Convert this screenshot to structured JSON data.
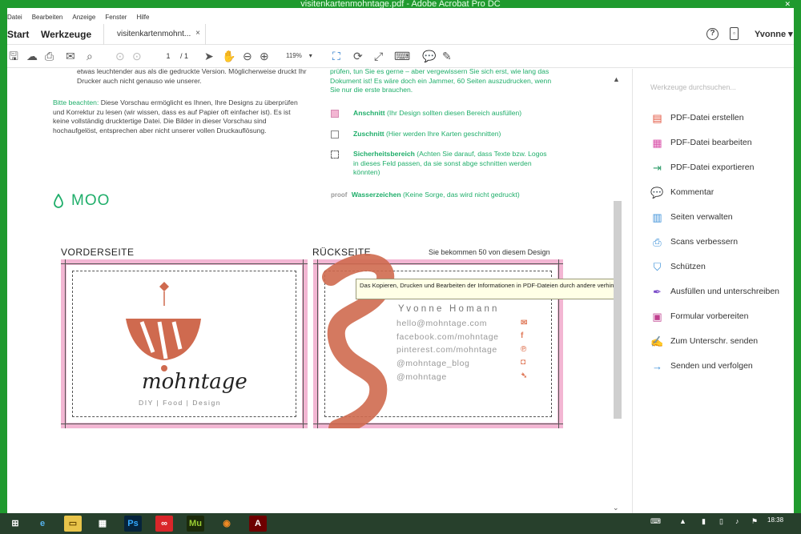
{
  "window": {
    "title": "visitenkartenmohntage.pdf - Adobe Acrobat Pro DC"
  },
  "menu": [
    "Datei",
    "Bearbeiten",
    "Anzeige",
    "Fenster",
    "Hilfe"
  ],
  "tabs": {
    "start": "Start",
    "tools": "Werkzeuge",
    "document": "visitenkartenmohnt...",
    "close": "×"
  },
  "header": {
    "user": "Yvonne"
  },
  "toolbar": {
    "page_current": "1",
    "page_total": "/ 1",
    "zoom": "119%"
  },
  "document": {
    "left_para1": "etwas leuchtender aus als die gedruckte Version. Möglicherweise druckt Ihr Drucker auch nicht genauso wie unserer.",
    "left_para2_hl": "Bitte beachten:",
    "left_para2": " Diese Vorschau ermöglicht es Ihnen, Ihre Designs zu überprüfen und Korrektur zu lesen (wir wissen, dass es auf Papier oft einfacher ist). Es ist keine vollständig drucktertige Datei. Die Bilder in dieser Vorschau sind hochaufgelöst, entsprechen aber nicht unserer vollen Druckauflösung.",
    "right_para": "prüfen, tun Sie es gerne – aber vergewissern Sie sich erst, wie lang das Dokument ist! Es wäre doch ein Jammer, 60 Seiten auszudrucken, wenn Sie nur die erste brauchen.",
    "legend": [
      {
        "term": "Anschnitt",
        "desc": " (Ihr Design sollten diesen Bereich ausfüllen)"
      },
      {
        "term": "Zuschnitt",
        "desc": " (Hier werden Ihre Karten geschnitten)"
      },
      {
        "term": "Sicherheitsbereich",
        "desc": " (Achten Sie darauf, dass Texte bzw. Logos in dieses Feld passen, da sie sonst abge schnitten werden könnten)"
      },
      {
        "prefix": "proof",
        "term": "Wasserzeichen",
        "desc": " (Keine Sorge, das wird nicht gedruckt)"
      }
    ],
    "logo": "MOO",
    "front_label": "VORDERSEITE",
    "back_label": "RÜCKSEITE",
    "count_label": "Sie bekommen 50 von diesem Design",
    "brand_name": "mohntage",
    "brand_sub": "DIY | Food | Design",
    "back_card": {
      "name": "Yvonne Homann",
      "lines": [
        "hello@mohntage.com",
        "facebook.com/mohntage",
        "pinterest.com/mohntage",
        "@mohntage_blog",
        "@mohntage"
      ]
    },
    "tooltip": "Das Kopieren, Drucken und Bearbeiten der Informationen in PDF-Dateien durch andere verhindern"
  },
  "tools_pane": {
    "search_placeholder": "Werkzeuge durchsuchen...",
    "items": [
      {
        "label": "PDF-Datei erstellen",
        "color": "#e2513b"
      },
      {
        "label": "PDF-Datei bearbeiten",
        "color": "#d84aa6"
      },
      {
        "label": "PDF-Datei exportieren",
        "color": "#2e9c6a"
      },
      {
        "label": "Kommentar",
        "color": "#f0c020"
      },
      {
        "label": "Seiten verwalten",
        "color": "#3a8fd8"
      },
      {
        "label": "Scans verbessern",
        "color": "#3a8fd8"
      },
      {
        "label": "Schützen",
        "color": "#3a8fd8"
      },
      {
        "label": "Ausfüllen und unterschreiben",
        "color": "#7b4dc9"
      },
      {
        "label": "Formular vorbereiten",
        "color": "#c0408f"
      },
      {
        "label": "Zum Unterschr. senden",
        "color": "#3a5fc9"
      },
      {
        "label": "Senden und verfolgen",
        "color": "#3a8fd8"
      }
    ]
  },
  "taskbar": {
    "time": "18:38"
  },
  "colors": {
    "accent": "#1fae6a",
    "bleed": "#f3b6d3",
    "brand": "#cf6a4f"
  }
}
